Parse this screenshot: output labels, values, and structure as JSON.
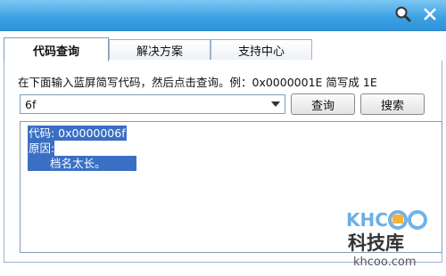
{
  "window": {
    "accent": "#3aa0e3"
  },
  "tabs": [
    {
      "label": "代码查询",
      "active": true
    },
    {
      "label": "解决方案",
      "active": false
    },
    {
      "label": "支持中心",
      "active": false
    }
  ],
  "instruction": "在下面输入蓝屏简写代码，然后点击查询。例：0x0000001E 简写成 1E",
  "code_input": {
    "value": "6f"
  },
  "buttons": {
    "query": "查询",
    "search": "搜索"
  },
  "result": {
    "code_line": "代码: 0x0000006f",
    "reason_label": "原因:",
    "reason_text": "档名太长。"
  },
  "watermark": {
    "brand": "KHCoo",
    "name": "科技库",
    "url": "khcoo.com"
  },
  "icons": {
    "search": "search-icon",
    "close": "close-icon",
    "dropdown": "chevron-down-icon"
  }
}
